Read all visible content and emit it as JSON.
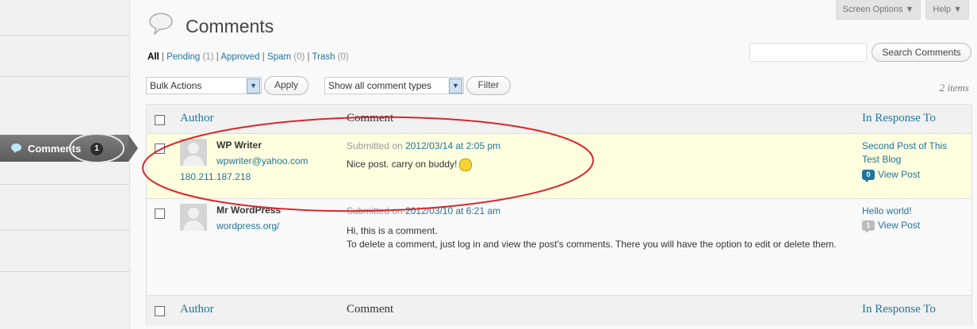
{
  "admin_menu": {
    "active_item": "Comments",
    "active_count": "1"
  },
  "header": {
    "title": "Comments",
    "screen_options": "Screen Options ▼",
    "help": "Help ▼"
  },
  "views": {
    "all": "All",
    "pending": "Pending",
    "pending_count": "(1)",
    "approved": "Approved",
    "spam": "Spam",
    "spam_count": "(0)",
    "trash": "Trash",
    "trash_count": "(0)",
    "sep": "|"
  },
  "search": {
    "button": "Search Comments",
    "value": ""
  },
  "toolbar": {
    "bulk_actions": "Bulk Actions",
    "apply": "Apply",
    "comment_types": "Show all comment types",
    "filter": "Filter",
    "items_count": "2 items"
  },
  "table": {
    "columns": {
      "author": "Author",
      "comment": "Comment",
      "response": "In Response To"
    },
    "rows": [
      {
        "author_name": "WP Writer",
        "author_email": "wpwriter@yahoo.com",
        "author_ip": "180.211.187.218",
        "submitted_prefix": "Submitted on",
        "submitted_date": "2012/03/14 at 2:05 pm",
        "text": "Nice post. carry on buddy!",
        "response_title": "Second Post of This Test Blog",
        "response_count": "0",
        "view_post": "View Post"
      },
      {
        "author_name": "Mr WordPress",
        "author_url": "wordpress.org/",
        "submitted_prefix": "Submitted on",
        "submitted_date": "2012/03/10 at 6:21 am",
        "text_line1": "Hi, this is a comment.",
        "text_line2": "To delete a comment, just log in and view the post's comments. There you will have the option to edit or delete them.",
        "response_title": "Hello world!",
        "response_count": "1",
        "view_post": "View Post"
      }
    ]
  },
  "colors": {
    "link": "#21759b",
    "highlight_row": "#ffffe0",
    "annotation": "#d9262b"
  }
}
